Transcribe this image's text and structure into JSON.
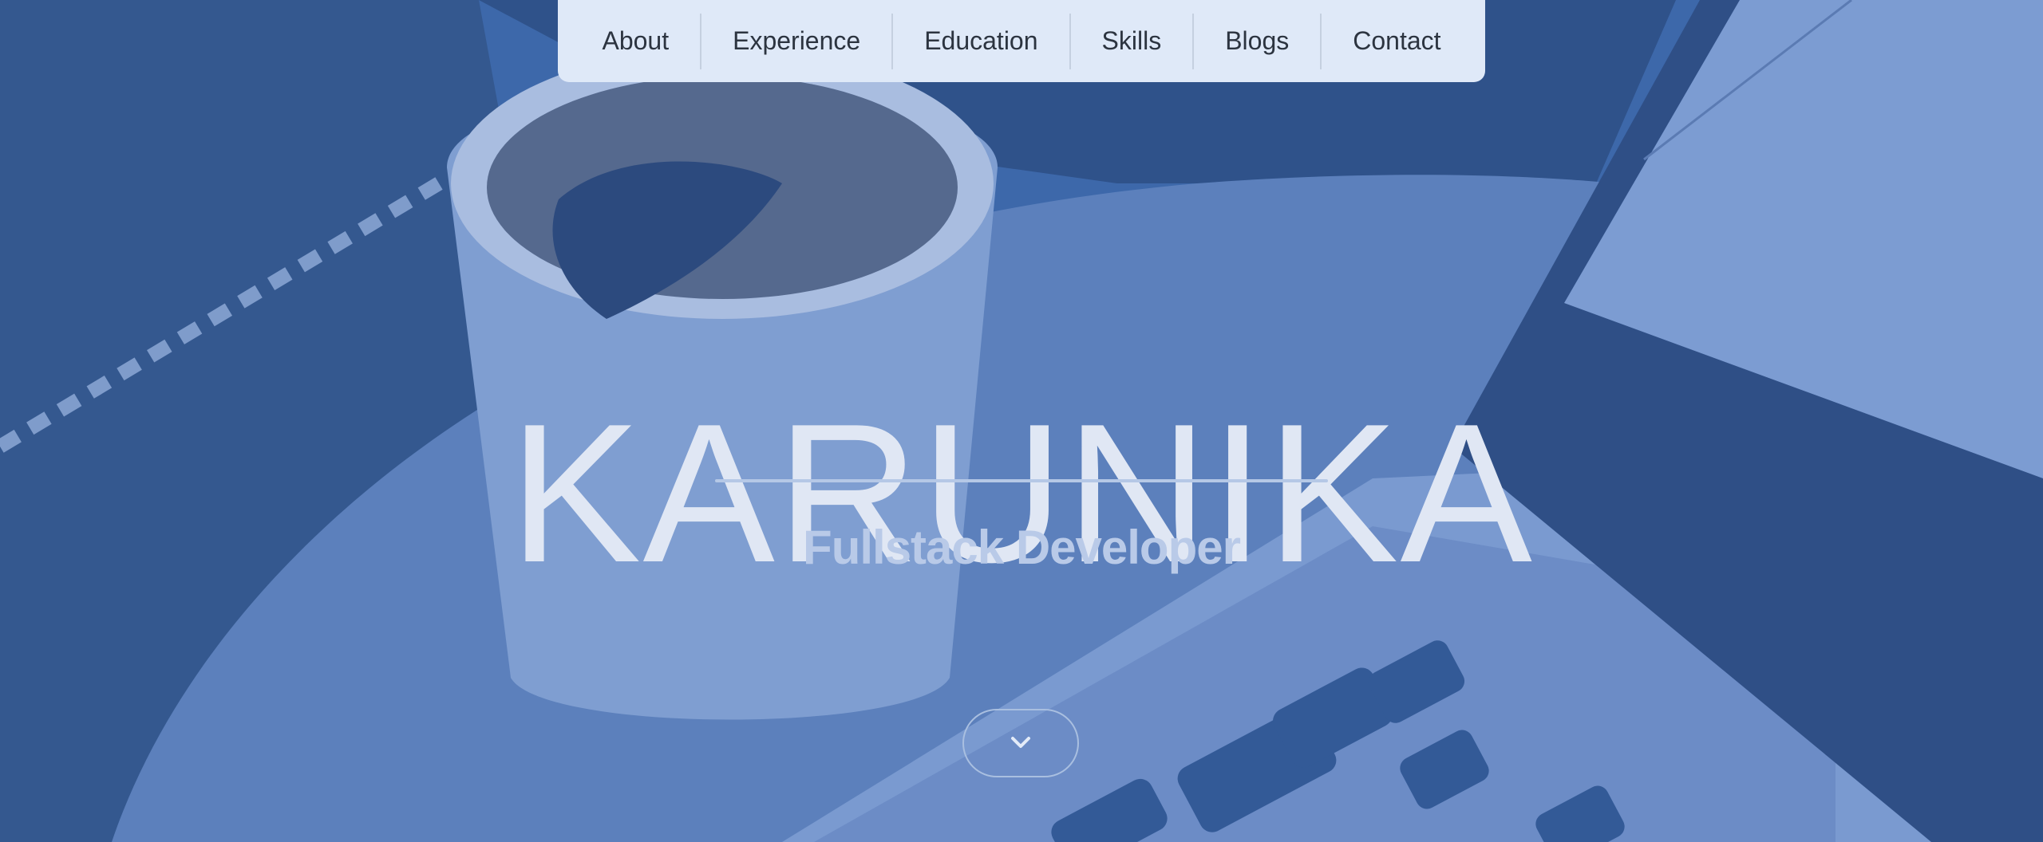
{
  "nav": {
    "items": [
      {
        "label": "About"
      },
      {
        "label": "Experience"
      },
      {
        "label": "Education"
      },
      {
        "label": "Skills"
      },
      {
        "label": "Blogs"
      },
      {
        "label": "Contact"
      }
    ]
  },
  "hero": {
    "name": "KARUNIKA",
    "role": "Fullstack Developer",
    "scroll_icon": "chevron-down-icon"
  },
  "colors": {
    "overlay": "#3c67a8",
    "nav_bg": "#dfe9f8",
    "title": "#e0e7f4",
    "subtitle": "#b9cae8"
  }
}
